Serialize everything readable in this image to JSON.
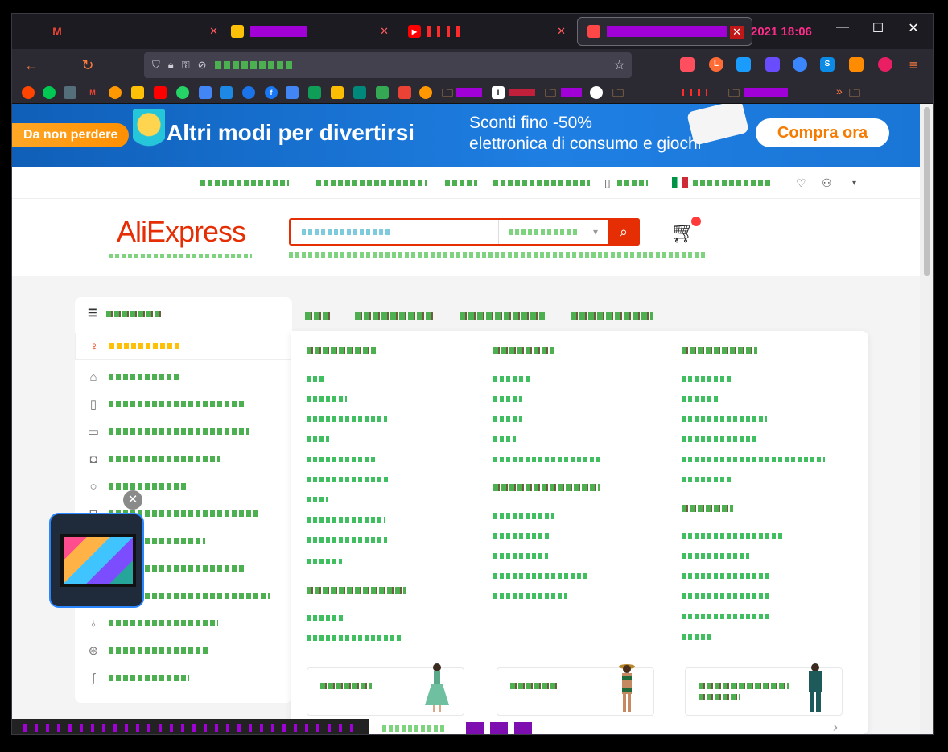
{
  "browser": {
    "tabs": [
      {
        "icon": "gmail-icon",
        "fav_text": "M",
        "color": "#ea4335"
      },
      {
        "icon": "app-icon",
        "fav_text": "",
        "color": "#ffc107"
      },
      {
        "icon": "youtube-icon",
        "fav_text": "▶",
        "color": "#ff0000"
      },
      {
        "icon": "aliexpress-icon",
        "fav_text": "",
        "color": "#ff4747"
      }
    ],
    "clock": "2021  18:06",
    "window_controls": {
      "minimize": "—",
      "maximize": "☐",
      "close": "✕"
    }
  },
  "banner": {
    "pill": "Da non perdere",
    "headline": "Altri modi per divertirsi",
    "sub_line1": "Sconti fino -50%",
    "sub_line2": "elettronica di consumo e giochi",
    "cta": "Compra ora"
  },
  "header": {
    "logo": "AliExpress"
  },
  "extensions": [
    {
      "color": "#ff4f5e"
    },
    {
      "color": "#ff6b35"
    },
    {
      "color": "#1a9cff"
    },
    {
      "color": "#6a4cff"
    },
    {
      "color": "#3a86ff"
    },
    {
      "color": "#0b8ae6"
    },
    {
      "color": "#ff8c00"
    },
    {
      "color": "#e91e63"
    }
  ],
  "bookmarks": [
    {
      "color": "#ff4500"
    },
    {
      "color": "#00c853"
    },
    {
      "color": "#546e7a"
    },
    {
      "color": "#ea4335"
    },
    {
      "color": "#ff9800"
    },
    {
      "color": "#ffc107"
    },
    {
      "color": "#ff0000"
    },
    {
      "color": "#25d366"
    },
    {
      "color": "#4285f4"
    },
    {
      "color": "#1e88e5"
    },
    {
      "color": "#1a73e8"
    },
    {
      "color": "#1877f2"
    },
    {
      "color": "#4285f4"
    },
    {
      "color": "#0f9d58"
    },
    {
      "color": "#fbbc04"
    },
    {
      "color": "#00897b"
    },
    {
      "color": "#34a853"
    },
    {
      "color": "#ea4335"
    }
  ]
}
